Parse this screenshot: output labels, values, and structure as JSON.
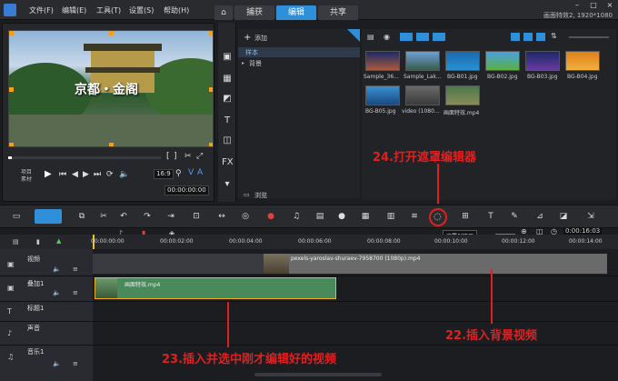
{
  "menu": {
    "file": "文件(F)",
    "edit": "编辑(E)",
    "tools": "工具(T)",
    "settings": "设置(S)",
    "help": "帮助(H)"
  },
  "tabs": {
    "capture": "捕获",
    "edit": "编辑",
    "share": "共享"
  },
  "project": {
    "info": "画面特效2, 1920*1080"
  },
  "preview": {
    "caption": "京都・金阁",
    "mode_project": "项目",
    "mode_clip": "素材",
    "timecode": "00:00:00:00",
    "zoom": "16:9"
  },
  "library": {
    "add_label": "添加",
    "items": [
      "样本",
      "背景"
    ],
    "browse_label": "浏览",
    "media": [
      "Sample_36...",
      "Sample_Lak...",
      "BG-B01.jpg",
      "BG-B02.jpg",
      "BG-B03.jpg",
      "BG-B04.jpg",
      "BG-B05.jpg",
      "video (1080...",
      "画面特效.mp4"
    ]
  },
  "toolbar": {
    "tooltip": "遮罩创建器",
    "timecode": "0:00:16:03"
  },
  "timeline": {
    "ticks": [
      "00:00:00:00",
      "00:00:02:00",
      "00:00:04:00",
      "00:00:06:00",
      "00:00:08:00",
      "00:00:10:00",
      "00:00:12:00",
      "00:00:14:00"
    ],
    "tracks": [
      "视频",
      "叠加1",
      "标题1",
      "声音",
      "音乐1"
    ],
    "video_clip": "pexels-yaroslav-shuraev-7958700 (1080p).mp4",
    "overlay_clip": "画面特效.mp4"
  },
  "annotations": {
    "a24": "24.打开遮罩编辑器",
    "a23": "23.插入并选中刚才编辑好的视频",
    "a22": "22.插入背景视频"
  },
  "colors": {
    "accent": "#2f8fd8",
    "annotation": "#e02020",
    "overlay_clip": "#4a8a5a",
    "video_clip": "#6a6a6a"
  }
}
